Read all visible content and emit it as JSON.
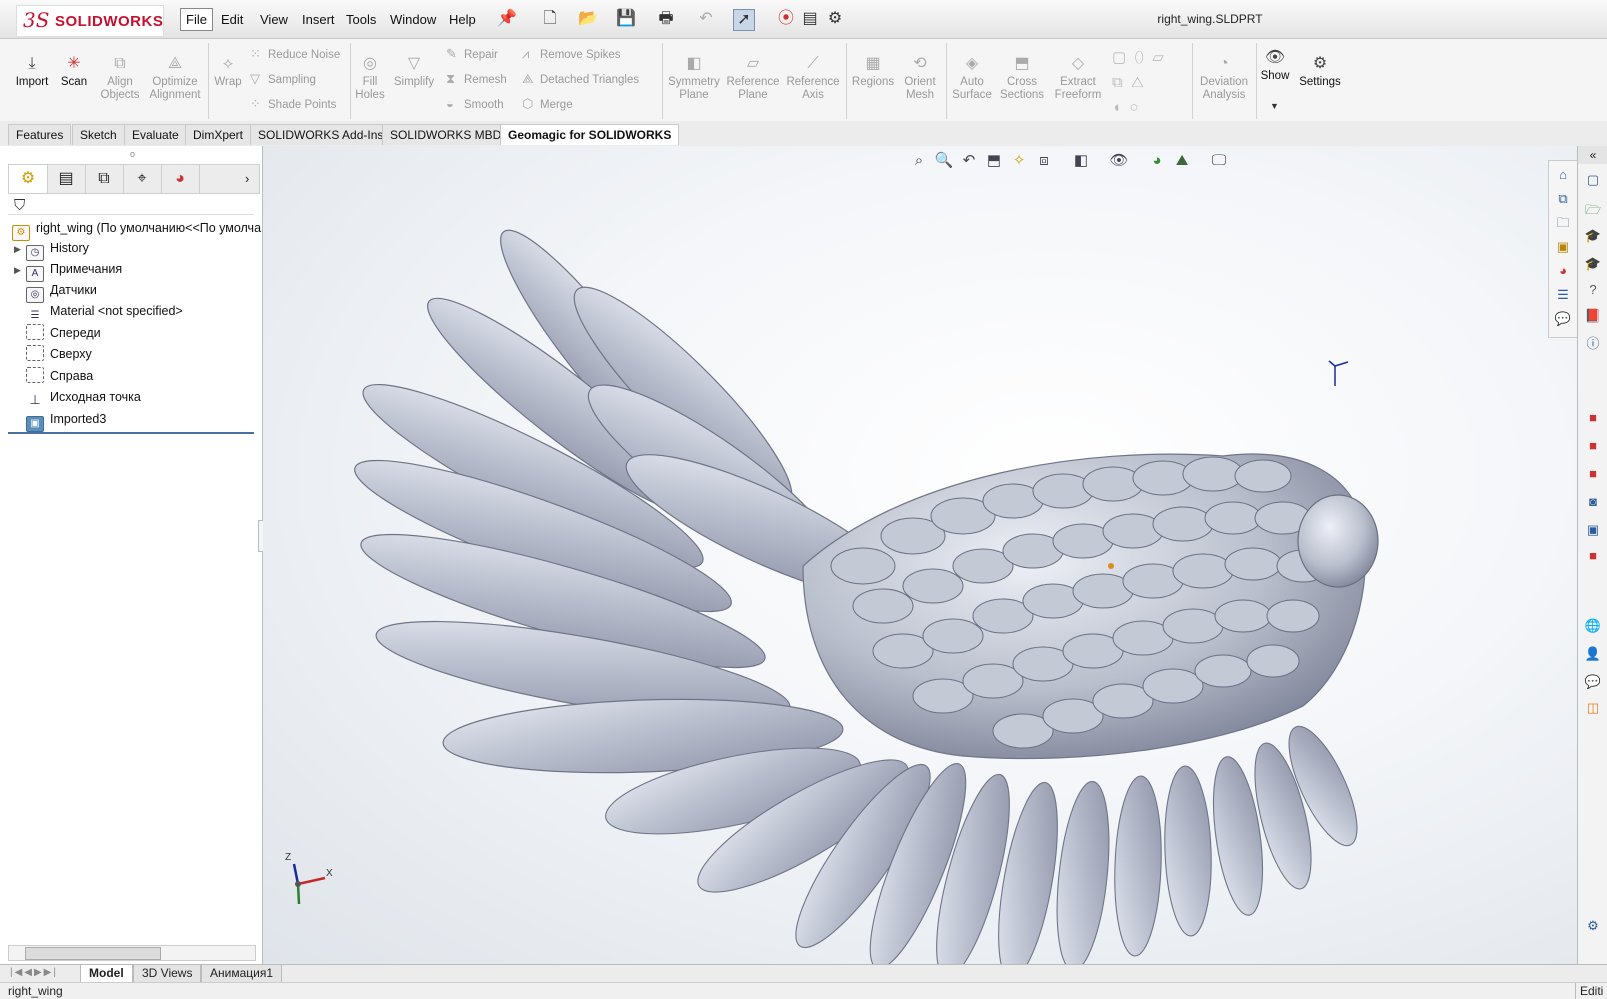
{
  "app": {
    "logo_prefix": "3S",
    "logo_text": "SOLIDWORKS",
    "window_title": "right_wing.SLDPRT"
  },
  "menu": [
    "File",
    "Edit",
    "View",
    "Insert",
    "Tools",
    "Window",
    "Help"
  ],
  "ribbon": {
    "import": "Import",
    "scan": "Scan",
    "align_objects": "Align Objects",
    "optimize_alignment": "Optimize Alignment",
    "wrap": "Wrap",
    "reduce_noise": "Reduce Noise",
    "sampling": "Sampling",
    "shade_points": "Shade Points",
    "fill_holes": "Fill Holes",
    "simplify": "Simplify",
    "repair": "Repair",
    "remesh": "Remesh",
    "smooth": "Smooth",
    "remove_spikes": "Remove Spikes",
    "detached_triangles": "Detached Triangles",
    "merge": "Merge",
    "symmetry_plane": "Symmetry Plane",
    "reference_plane": "Reference Plane",
    "reference_axis": "Reference Axis",
    "regions": "Regions",
    "orient_mesh": "Orient Mesh",
    "auto_surface": "Auto Surface",
    "cross_sections": "Cross Sections",
    "extract_freeform": "Extract Freeform",
    "deviation_analysis": "Deviation Analysis",
    "show": "Show",
    "settings": "Settings"
  },
  "tabs": [
    "Features",
    "Sketch",
    "Evaluate",
    "DimXpert",
    "SOLIDWORKS Add-Ins",
    "SOLIDWORKS MBD",
    "Geomagic for SOLIDWORKS"
  ],
  "tree": {
    "root": "right_wing  (По умолчанию<<По умолча",
    "items": [
      "History",
      "Примечания",
      "Датчики",
      "Material <not specified>",
      "Спереди",
      "Сверху",
      "Справа",
      "Исходная точка",
      "Imported3"
    ]
  },
  "bottom_tabs": [
    "Model",
    "3D Views",
    "Анимация1"
  ],
  "status": {
    "left": "right_wing",
    "right": "Editi"
  },
  "triad": {
    "x": "X",
    "z": "Z"
  }
}
